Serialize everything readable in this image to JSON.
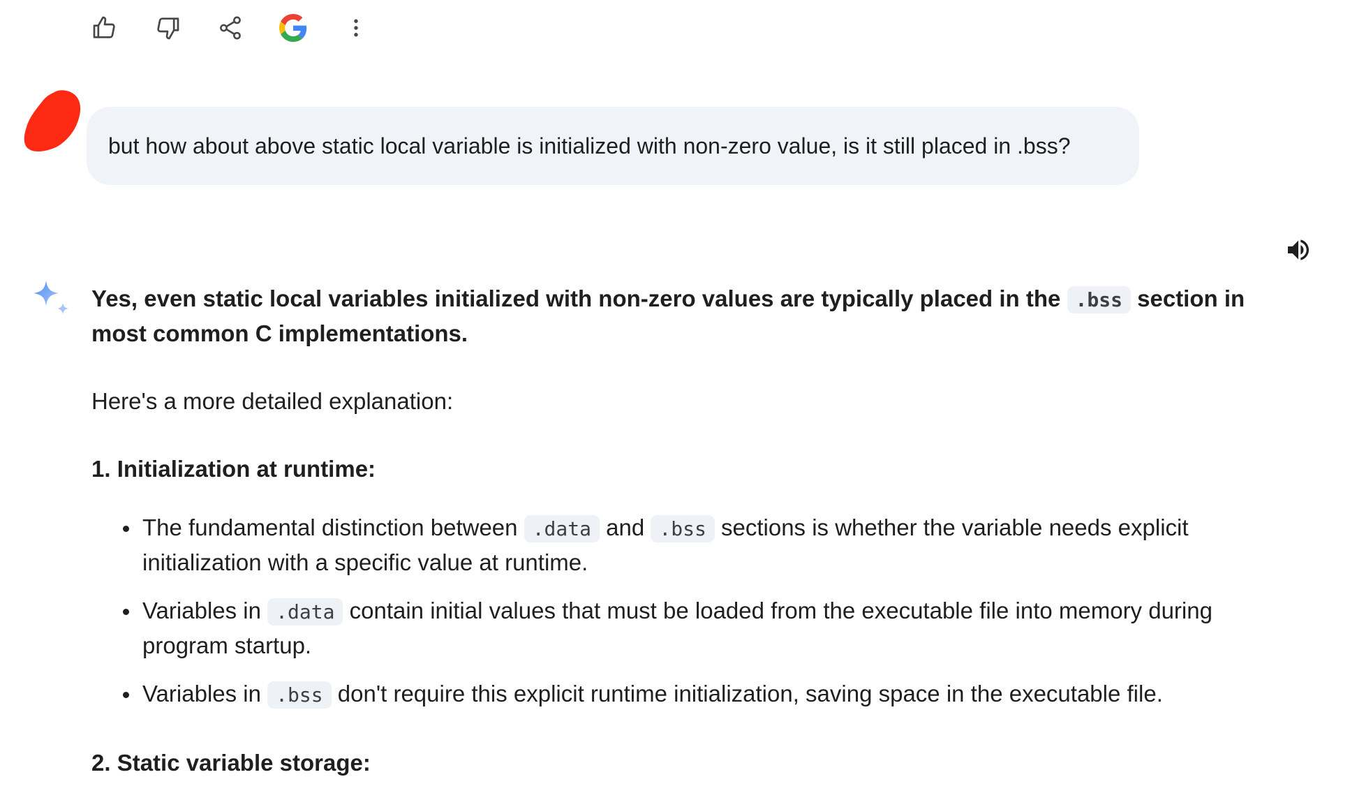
{
  "toolbar": {
    "icons": [
      "thumbs-up-icon",
      "thumbs-down-icon",
      "share-icon",
      "google-icon",
      "more-vert-icon"
    ]
  },
  "prompt": {
    "text": "but how about above static local variable is initialized with non-zero value, is it still placed in .bss?"
  },
  "response": {
    "lead_part1": "Yes, even static local variables initialized with non-zero values are typically placed in the ",
    "lead_code": ".bss",
    "lead_part2": " section in most common C implementations.",
    "intro": "Here's a more detailed explanation:",
    "section1_title": "1. Initialization at runtime:",
    "bullets": [
      {
        "t1": "The fundamental distinction between ",
        "c1": ".data",
        "t2": " and ",
        "c2": ".bss",
        "t3": " sections is whether the variable needs explicit initialization with a specific value at runtime."
      },
      {
        "t1": "Variables in ",
        "c1": ".data",
        "t2": " contain initial values that must be loaded from the executable file into memory during program startup."
      },
      {
        "t1": "Variables in ",
        "c1": ".bss",
        "t2": " don't require this explicit runtime initialization, saving space in the executable file."
      }
    ],
    "section2_title": "2. Static variable storage:"
  },
  "colors": {
    "bubble_bg": "#f0f4f9",
    "code_bg": "#eef1f6",
    "text": "#1f1f1f",
    "icon": "#444746",
    "spark": "#4c8df6",
    "avatar_red": "#ff2a14"
  }
}
